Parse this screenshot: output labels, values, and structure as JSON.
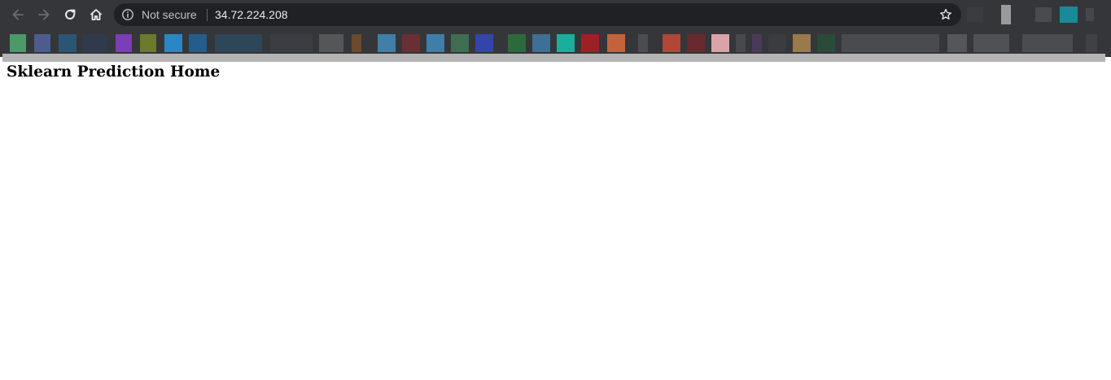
{
  "browser": {
    "security_label": "Not secure",
    "url": "34.72.224.208",
    "icons": {
      "back": "arrow-left-icon",
      "forward": "arrow-right-icon",
      "reload": "reload-icon",
      "home": "home-icon",
      "info": "info-icon",
      "bookmark_star": "star-icon"
    },
    "colors": {
      "chrome_bg": "#35363a",
      "omnibox_bg": "#202124",
      "url_text": "#e8eaed",
      "secondary_text": "#bdc1c6",
      "loading_bar": "#b4b4b4"
    }
  },
  "page": {
    "heading": "Sklearn Prediction Home"
  }
}
